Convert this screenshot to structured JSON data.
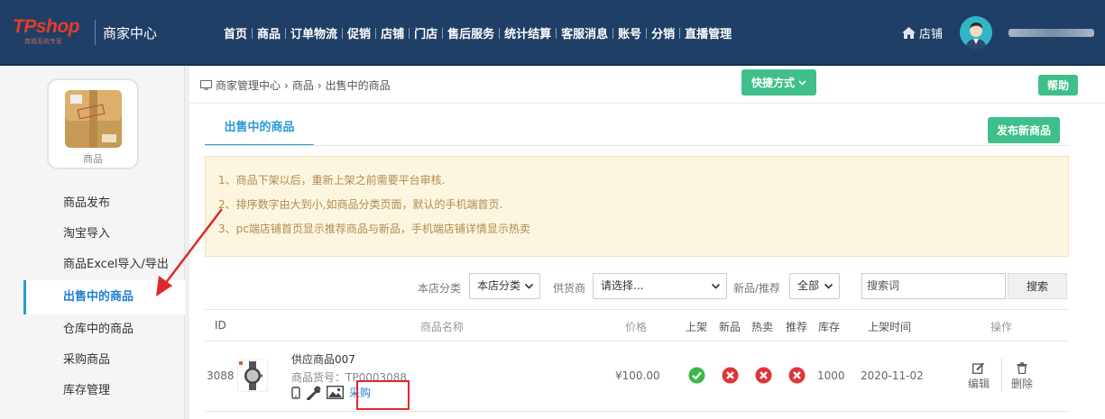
{
  "header": {
    "logo": "TPshop",
    "logo_sub": "商城系统专家",
    "center_title": "商家中心",
    "nav": [
      "首页",
      "商品",
      "订单物流",
      "促销",
      "店铺",
      "门店",
      "售后服务",
      "统计结算",
      "客服消息",
      "账号",
      "分销",
      "直播管理"
    ],
    "store_label": "店铺"
  },
  "sidebar": {
    "module_label": "商品",
    "items": [
      {
        "label": "商品发布",
        "active": false
      },
      {
        "label": "淘宝导入",
        "active": false
      },
      {
        "label": "商品Excel导入/导出",
        "active": false
      },
      {
        "label": "出售中的商品",
        "active": true
      },
      {
        "label": "仓库中的商品",
        "active": false
      },
      {
        "label": "采购商品",
        "active": false
      },
      {
        "label": "库存管理",
        "active": false
      }
    ]
  },
  "main": {
    "breadcrumb": [
      "商家管理中心",
      "商品",
      "出售中的商品"
    ],
    "quick_label": "快捷方式",
    "help_label": "帮助",
    "tab_label": "出售中的商品",
    "publish_label": "发布新商品",
    "notices": [
      "1、商品下架以后，重新上架之前需要平台审核.",
      "2、排序数字由大到小,如商品分类页面，默认的手机端首页.",
      "3、pc端店铺首页显示推荐商品与新品，手机端店铺详情显示热卖"
    ],
    "filters": {
      "store_category_label": "本店分类",
      "store_category_value": "本店分类",
      "supplier_label": "供货商",
      "supplier_value": "请选择...",
      "new_recommend_label": "新品/推荐",
      "new_recommend_value": "全部",
      "search_placeholder": "搜索词",
      "search_button": "搜索"
    },
    "table": {
      "headers": {
        "id": "ID",
        "name": "商品名称",
        "price": "价格",
        "on_shelf": "上架",
        "new": "新品",
        "hot": "热卖",
        "recommend": "推荐",
        "stock": "库存",
        "shelf_time": "上架时间",
        "actions": "操作"
      },
      "rows": [
        {
          "id": "3088",
          "name": "供应商品007",
          "sku": "商品货号：TP0003088",
          "price": "¥100.00",
          "on_shelf": true,
          "new": false,
          "hot": false,
          "recommend": false,
          "stock": "1000",
          "shelf_time": "2020-11-02",
          "purchase_link": "采购",
          "edit_label": "编辑",
          "delete_label": "删除"
        }
      ]
    }
  },
  "colors": {
    "header_bg": "#1f3f66",
    "accent_green": "#3fbf8a",
    "tab_blue": "#2a9ad8",
    "notice_bg": "#fcf6e0",
    "annotation_red": "#e0282a"
  }
}
